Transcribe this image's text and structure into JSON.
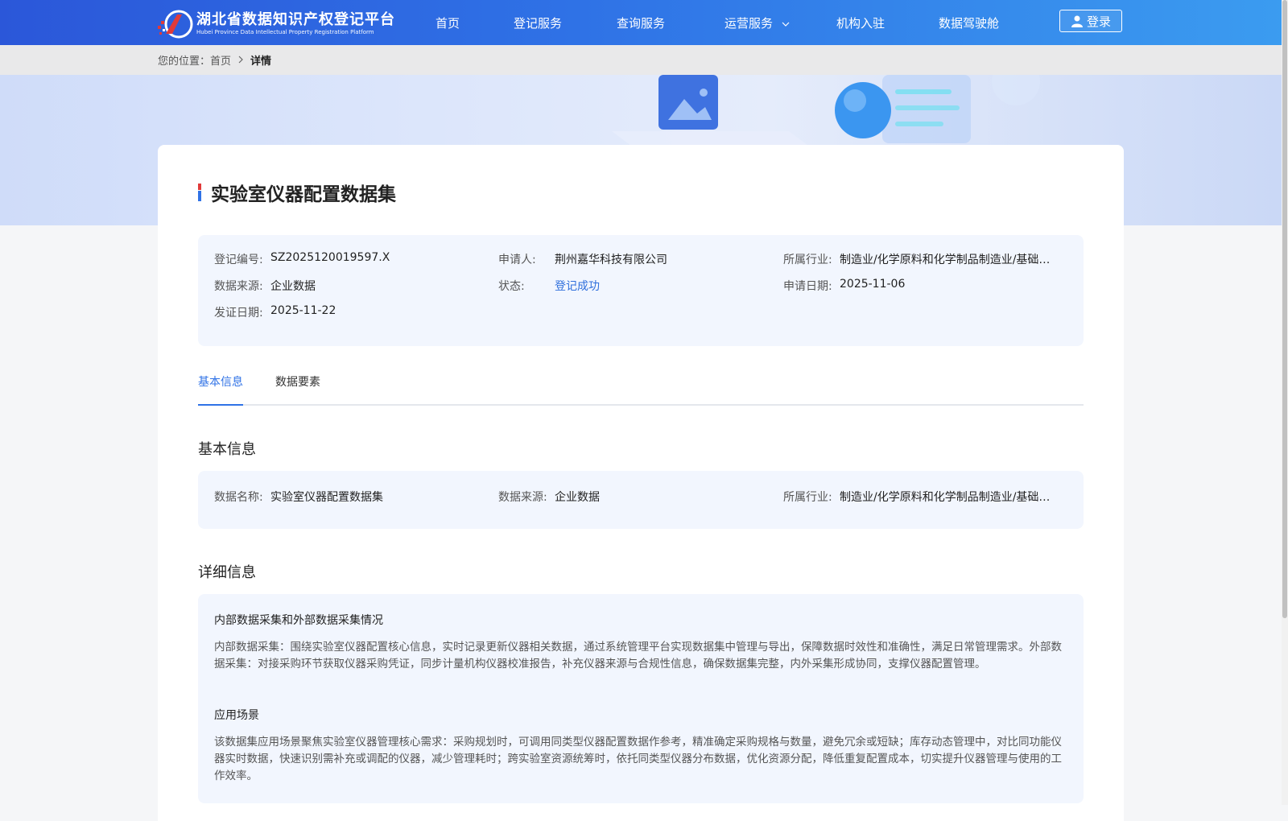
{
  "header": {
    "logo_cn": "湖北省数据知识产权登记平台",
    "logo_en": "Hubei Province Data Intellectual Property Registration Platform",
    "nav": [
      "首页",
      "登记服务",
      "查询服务",
      "运营服务",
      "机构入驻",
      "数据驾驶舱"
    ],
    "login_label": "登录"
  },
  "breadcrumb": {
    "prefix": "您的位置：",
    "home": "首页",
    "current": "详情"
  },
  "record": {
    "title": "实验室仪器配置数据集",
    "fields": {
      "reg_no_label": "登记编号:",
      "reg_no": "SZ2025120019597.X",
      "applicant_label": "申请人:",
      "applicant": "荆州嘉华科技有限公司",
      "industry_label": "所属行业:",
      "industry": "制造业/化学原料和化学制品制造业/基础…",
      "source_label": "数据来源:",
      "source": "企业数据",
      "status_label": "状态:",
      "status": "登记成功",
      "apply_date_label": "申请日期:",
      "apply_date": "2025-11-06",
      "cert_date_label": "发证日期:",
      "cert_date": "2025-11-22"
    }
  },
  "tabs": [
    "基本信息",
    "数据要素"
  ],
  "basic": {
    "section_title": "基本信息",
    "name_label": "数据名称:",
    "name": "实验室仪器配置数据集",
    "source_label": "数据来源:",
    "source": "企业数据",
    "industry_label": "所属行业:",
    "industry": "制造业/化学原料和化学制品制造业/基础…"
  },
  "detail": {
    "section_title": "详细信息",
    "h1": "内部数据采集和外部数据采集情况",
    "p1": "内部数据采集：围绕实验室仪器配置核心信息，实时记录更新仪器相关数据，通过系统管理平台实现数据集中管理与导出，保障数据时效性和准确性，满足日常管理需求。外部数据采集：对接采购环节获取仪器采购凭证，同步计量机构仪器校准报告，补充仪器来源与合规性信息，确保数据集完整，内外采集形成协同，支撑仪器配置管理。",
    "h2": "应用场景",
    "p2": "该数据集应用场景聚焦实验室仪器管理核心需求：采购规划时，可调用同类型仪器配置数据作参考，精准确定采购规格与数量，避免冗余或短缺；库存动态管理中，对比同功能仪器实时数据，快速识别需补充或调配的仪器，减少管理耗时；跨实验室资源统筹时，依托同类型仪器分布数据，优化资源分配，降低重复配置成本，切实提升仪器管理与使用的工作效率。"
  }
}
